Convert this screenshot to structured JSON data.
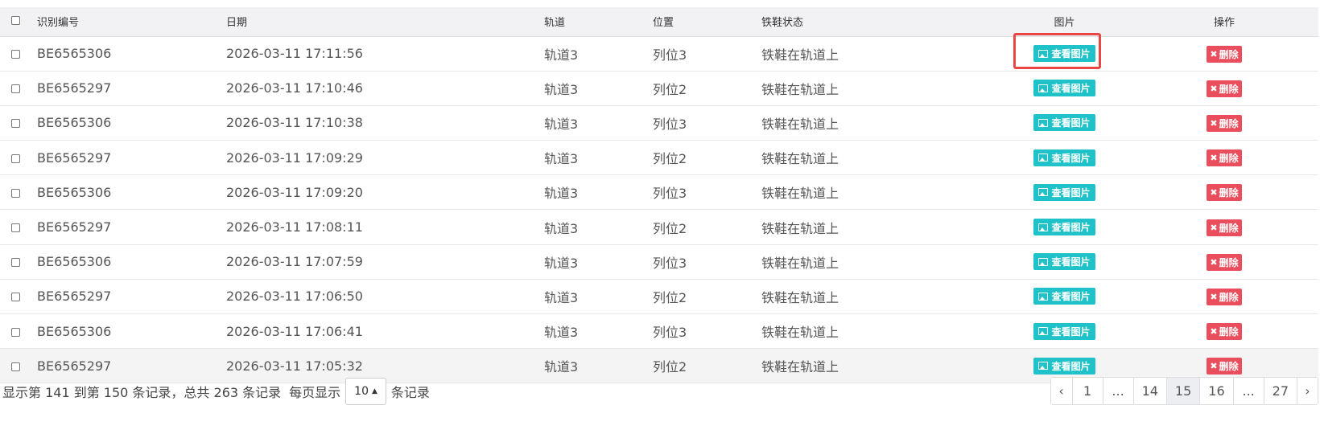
{
  "columns": {
    "id": "识别编号",
    "date": "日期",
    "track": "轨道",
    "position": "位置",
    "status": "铁鞋状态",
    "image": "图片",
    "action": "操作"
  },
  "rows": [
    {
      "id": "BE6565306",
      "date": "2026-03-11 17:11:56",
      "track": "轨道3",
      "position": "列位3",
      "status": "铁鞋在轨道上"
    },
    {
      "id": "BE6565297",
      "date": "2026-03-11 17:10:46",
      "track": "轨道3",
      "position": "列位2",
      "status": "铁鞋在轨道上"
    },
    {
      "id": "BE6565306",
      "date": "2026-03-11 17:10:38",
      "track": "轨道3",
      "position": "列位3",
      "status": "铁鞋在轨道上"
    },
    {
      "id": "BE6565297",
      "date": "2026-03-11 17:09:29",
      "track": "轨道3",
      "position": "列位2",
      "status": "铁鞋在轨道上"
    },
    {
      "id": "BE6565306",
      "date": "2026-03-11 17:09:20",
      "track": "轨道3",
      "position": "列位3",
      "status": "铁鞋在轨道上"
    },
    {
      "id": "BE6565297",
      "date": "2026-03-11 17:08:11",
      "track": "轨道3",
      "position": "列位2",
      "status": "铁鞋在轨道上"
    },
    {
      "id": "BE6565306",
      "date": "2026-03-11 17:07:59",
      "track": "轨道3",
      "position": "列位3",
      "status": "铁鞋在轨道上"
    },
    {
      "id": "BE6565297",
      "date": "2026-03-11 17:06:50",
      "track": "轨道3",
      "position": "列位2",
      "status": "铁鞋在轨道上"
    },
    {
      "id": "BE6565306",
      "date": "2026-03-11 17:06:41",
      "track": "轨道3",
      "position": "列位3",
      "status": "铁鞋在轨道上"
    },
    {
      "id": "BE6565297",
      "date": "2026-03-11 17:05:32",
      "track": "轨道3",
      "position": "列位2",
      "status": "铁鞋在轨道上"
    }
  ],
  "row_buttons": {
    "view_label": "查看图片",
    "view_icon": "image-icon",
    "delete_label": "删除",
    "delete_icon": "x-icon"
  },
  "footer": {
    "summary": "显示第 141 到第 150 条记录，总共 263 条记录",
    "per_page_prefix": "每页显示",
    "per_page_value": "10",
    "per_page_suffix": "条记录"
  },
  "pagination": {
    "prev": "‹",
    "pages": [
      "1",
      "...",
      "14",
      "15",
      "16",
      "...",
      "27"
    ],
    "active": "15",
    "next": "›"
  },
  "colors": {
    "view_button": "#1fc2c8",
    "delete_button": "#ea4d5c",
    "highlight_outline": "#e94646"
  }
}
